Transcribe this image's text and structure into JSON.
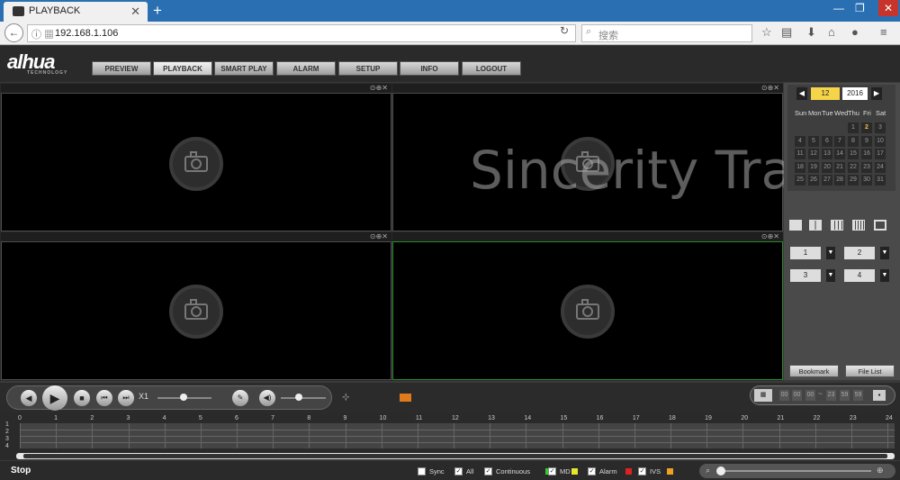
{
  "browser": {
    "tab_title": "PLAYBACK",
    "url": "192.168.1.106",
    "search_placeholder": "搜索",
    "new_tab": "+"
  },
  "app": {
    "logo": "alhua",
    "logo_sub": "TECHNOLOGY",
    "menu": [
      "PREVIEW",
      "PLAYBACK",
      "SMART PLAY",
      "ALARM",
      "SETUP",
      "INFO",
      "LOGOUT"
    ],
    "active_menu": "PLAYBACK"
  },
  "watermark": "Sincerity Trade",
  "calendar": {
    "month": "12",
    "year": "2016",
    "weekdays": [
      "Sun",
      "Mon",
      "Tue",
      "Wed",
      "Thu",
      "Fri",
      "Sat"
    ],
    "weeks": [
      [
        "",
        "",
        "",
        "",
        "1",
        "2",
        "3"
      ],
      [
        "4",
        "5",
        "6",
        "7",
        "8",
        "9",
        "10"
      ],
      [
        "11",
        "12",
        "13",
        "14",
        "15",
        "16",
        "17"
      ],
      [
        "18",
        "19",
        "20",
        "21",
        "22",
        "23",
        "24"
      ],
      [
        "25",
        "26",
        "27",
        "28",
        "29",
        "30",
        "31"
      ]
    ],
    "highlighted_day": "2"
  },
  "channels": [
    "1",
    "2",
    "3",
    "4"
  ],
  "buttons": {
    "bookmark": "Bookmark",
    "file_list": "File List"
  },
  "playback": {
    "speed": "X1",
    "time_start": [
      "00",
      "00",
      "00"
    ],
    "time_sep": "~",
    "time_end": [
      "23",
      "59",
      "59"
    ]
  },
  "timeline": {
    "hours": [
      "0",
      "1",
      "2",
      "3",
      "4",
      "5",
      "6",
      "7",
      "8",
      "9",
      "10",
      "11",
      "12",
      "13",
      "14",
      "15",
      "16",
      "17",
      "18",
      "19",
      "20",
      "21",
      "22",
      "23",
      "24"
    ],
    "rows": [
      "1",
      "2",
      "3",
      "4"
    ]
  },
  "status": "Stop",
  "filters": [
    {
      "label": "Sync",
      "checked": false,
      "color": ""
    },
    {
      "label": "All",
      "checked": true,
      "color": ""
    },
    {
      "label": "Continuous",
      "checked": true,
      "color": "#33cc33"
    },
    {
      "label": "MD",
      "checked": true,
      "color": "#e6e62e"
    },
    {
      "label": "Alarm",
      "checked": true,
      "color": "#dd2222"
    },
    {
      "label": "IVS",
      "checked": true,
      "color": "#f0a020"
    }
  ],
  "colors": {
    "accent_green": "#2a8a2a",
    "highlight_yellow": "#f5d44a"
  }
}
